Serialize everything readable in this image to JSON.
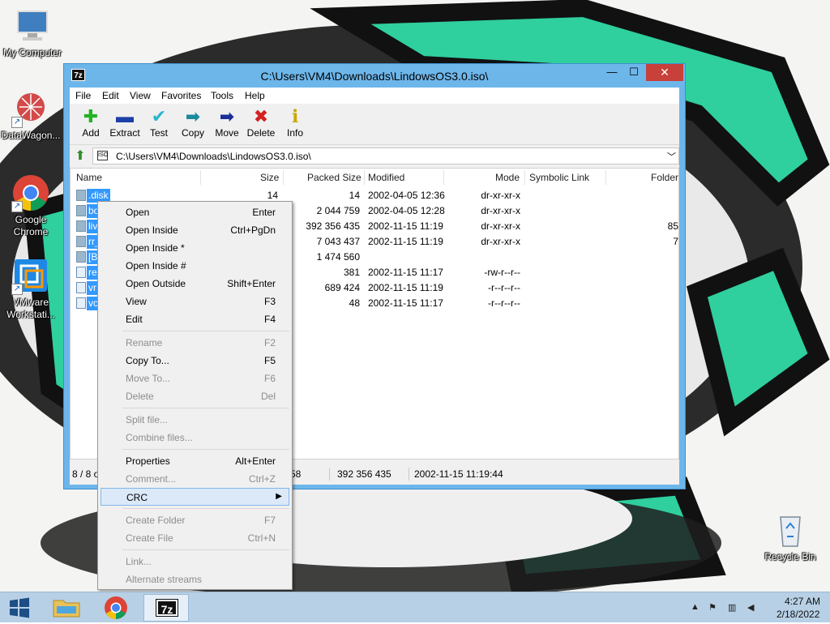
{
  "desktop": {
    "icons": [
      {
        "label": "My Computer",
        "icon": "computer-icon"
      },
      {
        "label": "DataWagon...",
        "icon": "datawagon-icon"
      },
      {
        "label": "Google Chrome",
        "icon": "chrome-icon"
      },
      {
        "label": "VMware Workstati...",
        "icon": "vmware-icon"
      },
      {
        "label": "Recycle Bin",
        "icon": "recycle-bin-icon"
      }
    ]
  },
  "window": {
    "title": "C:\\Users\\VM4\\Downloads\\LindowsOS3.0.iso\\",
    "app_icon_text": "7z",
    "controls": {
      "minimize": "—",
      "maximize": "☐",
      "close": "✕"
    },
    "menu": [
      "File",
      "Edit",
      "View",
      "Favorites",
      "Tools",
      "Help"
    ],
    "toolbar": [
      {
        "label": "Add",
        "icon": "add-icon",
        "glyph": "✚",
        "color": "#22b322"
      },
      {
        "label": "Extract",
        "icon": "extract-icon",
        "glyph": "▬",
        "color": "#1c3fa8"
      },
      {
        "label": "Test",
        "icon": "test-icon",
        "glyph": "✔",
        "color": "#29b6c9"
      },
      {
        "label": "Copy",
        "icon": "copy-icon",
        "glyph": "➡",
        "color": "#1b8a9e"
      },
      {
        "label": "Move",
        "icon": "move-icon",
        "glyph": "➡",
        "color": "#1c2f99"
      },
      {
        "label": "Delete",
        "icon": "delete-icon",
        "glyph": "✖",
        "color": "#d42020"
      },
      {
        "label": "Info",
        "icon": "info-icon",
        "glyph": "ℹ",
        "color": "#c8a800"
      }
    ],
    "address": {
      "value": "C:\\Users\\VM4\\Downloads\\LindowsOS3.0.iso\\",
      "icon_text": "ISO"
    },
    "columns": [
      "Name",
      "Size",
      "Packed Size",
      "Modified",
      "Mode",
      "Symbolic Link",
      "Folder"
    ],
    "rows": [
      {
        "name": ".disk",
        "size": "14",
        "packed": "14",
        "modified": "2002-04-05 12:36",
        "mode": "dr-xr-xr-x",
        "symlink": "",
        "folder": "",
        "type": "folder"
      },
      {
        "name": "bo",
        "size": "",
        "packed": "2 044 759",
        "modified": "2002-04-05 12:28",
        "mode": "dr-xr-xr-x",
        "symlink": "",
        "folder": "",
        "type": "folder"
      },
      {
        "name": "liv",
        "size": "",
        "packed": "392 356 435",
        "modified": "2002-11-15 11:19",
        "mode": "dr-xr-xr-x",
        "symlink": "",
        "folder": "85",
        "type": "folder"
      },
      {
        "name": "rr_",
        "size": "",
        "packed": "7 043 437",
        "modified": "2002-11-15 11:19",
        "mode": "dr-xr-xr-x",
        "symlink": "",
        "folder": "7",
        "type": "folder"
      },
      {
        "name": "[B",
        "size": "",
        "packed": "1 474 560",
        "modified": "",
        "mode": "",
        "symlink": "",
        "folder": "",
        "type": "folder"
      },
      {
        "name": "re",
        "size": "",
        "packed": "381",
        "modified": "2002-11-15 11:17",
        "mode": "-rw-r--r--",
        "symlink": "",
        "folder": "",
        "type": "doc"
      },
      {
        "name": "vr",
        "size": "",
        "packed": "689 424",
        "modified": "2002-11-15 11:19",
        "mode": "-r--r--r--",
        "symlink": "",
        "folder": "",
        "type": "doc"
      },
      {
        "name": "vc",
        "size": "",
        "packed": "48",
        "modified": "2002-11-15 11:17",
        "mode": "-r--r--r--",
        "symlink": "",
        "folder": "",
        "type": "doc"
      }
    ],
    "status": {
      "selection": "8 / 8 o",
      "size": "58",
      "packed": "392 356 435",
      "modified": "2002-11-15 11:19:44"
    }
  },
  "context_menu": {
    "items": [
      {
        "label": "Open",
        "shortcut": "Enter",
        "enabled": true
      },
      {
        "label": "Open Inside",
        "shortcut": "Ctrl+PgDn",
        "enabled": true
      },
      {
        "label": "Open Inside *",
        "shortcut": "",
        "enabled": true
      },
      {
        "label": "Open Inside #",
        "shortcut": "",
        "enabled": true
      },
      {
        "label": "Open Outside",
        "shortcut": "Shift+Enter",
        "enabled": true
      },
      {
        "label": "View",
        "shortcut": "F3",
        "enabled": true
      },
      {
        "label": "Edit",
        "shortcut": "F4",
        "enabled": true
      },
      {
        "sep": true
      },
      {
        "label": "Rename",
        "shortcut": "F2",
        "enabled": false
      },
      {
        "label": "Copy To...",
        "shortcut": "F5",
        "enabled": true
      },
      {
        "label": "Move To...",
        "shortcut": "F6",
        "enabled": false
      },
      {
        "label": "Delete",
        "shortcut": "Del",
        "enabled": false
      },
      {
        "sep": true
      },
      {
        "label": "Split file...",
        "shortcut": "",
        "enabled": false
      },
      {
        "label": "Combine files...",
        "shortcut": "",
        "enabled": false
      },
      {
        "sep": true
      },
      {
        "label": "Properties",
        "shortcut": "Alt+Enter",
        "enabled": true
      },
      {
        "label": "Comment...",
        "shortcut": "Ctrl+Z",
        "enabled": false
      },
      {
        "label": "CRC",
        "shortcut": "",
        "enabled": true,
        "submenu": true,
        "active": true
      },
      {
        "sep": true
      },
      {
        "label": "Create Folder",
        "shortcut": "F7",
        "enabled": false
      },
      {
        "label": "Create File",
        "shortcut": "Ctrl+N",
        "enabled": false
      },
      {
        "sep": true
      },
      {
        "label": "Link...",
        "shortcut": "",
        "enabled": false
      },
      {
        "label": "Alternate streams",
        "shortcut": "",
        "enabled": false
      }
    ]
  },
  "taskbar": {
    "apps": [
      {
        "icon": "file-explorer-icon"
      },
      {
        "icon": "chrome-icon"
      },
      {
        "icon": "7zip-icon",
        "text": "7z"
      }
    ],
    "tray": {
      "icons": [
        "show-hidden-icon",
        "action-center-icon",
        "network-icon",
        "volume-icon"
      ],
      "time": "4:27 AM",
      "date": "2/18/2022"
    }
  },
  "colors": {
    "accent": "#6db6ea",
    "selection": "#3399ff",
    "close": "#c7403a",
    "teal": "#2fcf9e"
  }
}
